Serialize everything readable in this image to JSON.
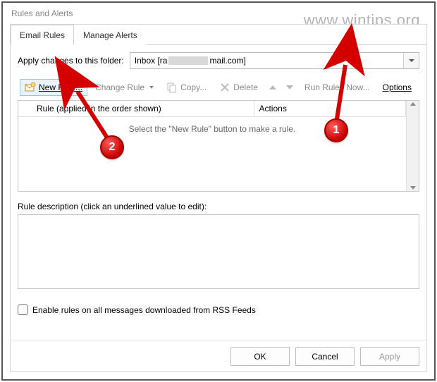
{
  "window": {
    "title": "Rules and Alerts"
  },
  "watermark": "www.wintips.org",
  "tabs": {
    "email_rules": "Email Rules",
    "manage_alerts": "Manage Alerts"
  },
  "folder": {
    "label": "Apply changes to this folder:",
    "prefix": "Inbox [ra",
    "suffix": "mail.com]"
  },
  "toolbar": {
    "new_rule": "New Rule...",
    "change_rule": "Change Rule",
    "copy": "Copy...",
    "delete": "Delete",
    "run_rules_now": "Run Rules Now...",
    "options": "Options"
  },
  "rules_list": {
    "col_rule": "Rule (applied in the order shown)",
    "col_actions": "Actions",
    "empty_text": "Select the \"New Rule\" button to make a rule."
  },
  "description": {
    "label": "Rule description (click an underlined value to edit):"
  },
  "rss": {
    "label": "Enable rules on all messages downloaded from RSS Feeds"
  },
  "buttons": {
    "ok": "OK",
    "cancel": "Cancel",
    "apply": "Apply"
  },
  "annotation": {
    "marker1": "1",
    "marker2": "2"
  }
}
